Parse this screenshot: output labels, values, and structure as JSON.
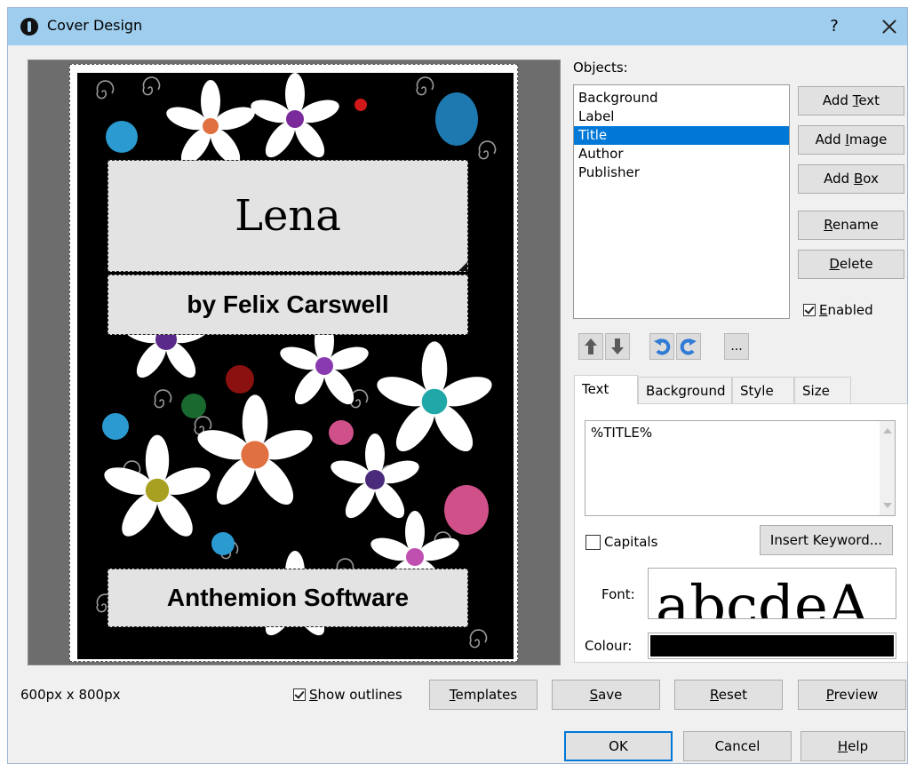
{
  "window": {
    "title": "Cover Design",
    "help_glyph": "?"
  },
  "cover": {
    "title": "Lena",
    "author": "by Felix Carswell",
    "publisher": "Anthemion Software"
  },
  "objects": {
    "label": "Objects:",
    "items": [
      {
        "label": "Background",
        "selected": false
      },
      {
        "label": "Label",
        "selected": false
      },
      {
        "label": "Title",
        "selected": true
      },
      {
        "label": "Author",
        "selected": false
      },
      {
        "label": "Publisher",
        "selected": false
      }
    ]
  },
  "buttons": {
    "add_text": {
      "pre": "Add ",
      "ul": "T",
      "post": "ext"
    },
    "add_image": {
      "pre": "Add ",
      "ul": "I",
      "post": "mage"
    },
    "add_box": {
      "pre": "Add ",
      "ul": "B",
      "post": "ox"
    },
    "rename": {
      "pre": "",
      "ul": "R",
      "post": "ename"
    },
    "delete": {
      "pre": "",
      "ul": "D",
      "post": "elete"
    },
    "templates": {
      "pre": "",
      "ul": "T",
      "post": "emplates"
    },
    "save": {
      "pre": "",
      "ul": "S",
      "post": "ave"
    },
    "reset": {
      "pre": "",
      "ul": "R",
      "post": "eset"
    },
    "preview": {
      "pre": "",
      "ul": "P",
      "post": "review"
    },
    "ok": "OK",
    "cancel": "Cancel",
    "help": {
      "pre": "",
      "ul": "H",
      "post": "elp"
    },
    "insert_keyword": "Insert Keyword...",
    "more": "..."
  },
  "enabled": {
    "pre": "",
    "ul": "E",
    "post": "nabled",
    "checked": true
  },
  "show_outlines": {
    "pre": "",
    "ul": "S",
    "post": "how outlines",
    "checked": true
  },
  "tabs": [
    {
      "label": "Text",
      "active": true
    },
    {
      "label": "Background",
      "active": false
    },
    {
      "label": "Style",
      "active": false
    },
    {
      "label": "Size",
      "active": false
    }
  ],
  "text_panel": {
    "value": "%TITLE%",
    "capitals_label": "Capitals",
    "capitals_checked": false,
    "font_label": "Font:",
    "font_preview": "abcdeA",
    "colour_label": "Colour:",
    "colour_value": "#000000"
  },
  "status": {
    "dimensions": "600px x 800px"
  },
  "icons": [
    "move-up-icon",
    "move-down-icon",
    "undo-icon",
    "redo-icon",
    "close-icon",
    "app-icon"
  ],
  "colors": {
    "titlebar": "#9fcdee",
    "selection": "#0078d7",
    "arrow_icon": "#5a5a5a",
    "undo_redo_icon": "#2f7bd6"
  }
}
